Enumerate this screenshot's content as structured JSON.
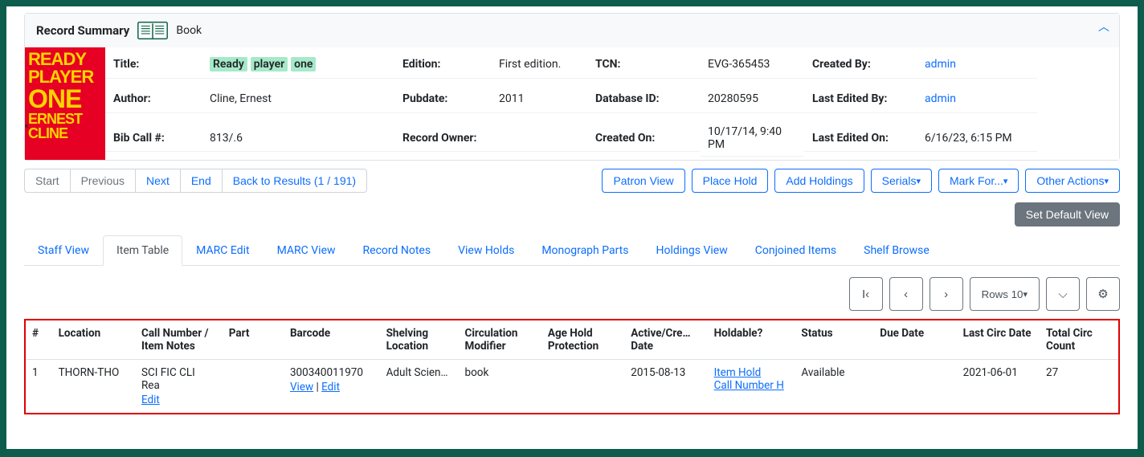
{
  "summary": {
    "heading": "Record Summary",
    "type": "Book",
    "labels": {
      "title": "Title:",
      "author": "Author:",
      "bib_call": "Bib Call #:",
      "edition": "Edition:",
      "pubdate": "Pubdate:",
      "record_owner": "Record Owner:",
      "tcn": "TCN:",
      "db_id": "Database ID:",
      "created_on": "Created On:",
      "created_by": "Created By:",
      "last_edited_by": "Last Edited By:",
      "last_edited_on": "Last Edited On:"
    },
    "title_words": [
      "Ready",
      "player",
      "one"
    ],
    "author": "Cline, Ernest",
    "bib_call": "813/.6",
    "edition": "First edition.",
    "pubdate": "2011",
    "record_owner": "",
    "tcn": "EVG-365453",
    "db_id": "20280595",
    "created_on": "10/17/14, 9:40 PM",
    "created_by": "admin",
    "last_edited_by": "admin",
    "last_edited_on": "6/16/23, 6:15 PM"
  },
  "cover_text": {
    "l1": "READY",
    "l2": "PLAYER",
    "l3": "ONE",
    "l4": "ERNEST",
    "l5": "CLINE"
  },
  "nav": {
    "start": "Start",
    "previous": "Previous",
    "next": "Next",
    "end": "End",
    "back": "Back to Results (1 / 191)"
  },
  "actions": {
    "patron_view": "Patron View",
    "place_hold": "Place Hold",
    "add_holdings": "Add Holdings",
    "serials": "Serials",
    "mark_for": "Mark For...",
    "other_actions": "Other Actions",
    "set_default": "Set Default View"
  },
  "tabs": [
    "Staff View",
    "Item Table",
    "MARC Edit",
    "MARC View",
    "Record Notes",
    "View Holds",
    "Monograph Parts",
    "Holdings View",
    "Conjoined Items",
    "Shelf Browse"
  ],
  "active_tab": "Item Table",
  "table_controls": {
    "rows_label": "Rows 10"
  },
  "table": {
    "headers": [
      "#",
      "Location",
      "Call Number / Item Notes",
      "Part",
      "Barcode",
      "Shelving Location",
      "Circulation Modifier",
      "Age Hold Protection",
      "Active/Cre… Date",
      "Holdable?",
      "Status",
      "Due Date",
      "Last Circ Date",
      "Total Circ Count"
    ],
    "row": {
      "num": "1",
      "location": "THORN-THO",
      "call_number": "SCI FIC CLI Rea",
      "call_edit": "Edit",
      "part": "",
      "barcode": "300340011970",
      "barcode_view": "View",
      "barcode_edit": "Edit",
      "barcode_sep": " | ",
      "shelving": "Adult Scien…",
      "circ_mod": "book",
      "age_hold": "",
      "active_date": "2015-08-13",
      "holdable_item": "Item Hold",
      "holdable_call": "Call Number H",
      "status": "Available",
      "due_date": "",
      "last_circ": "2021-06-01",
      "total_circ": "27"
    }
  }
}
